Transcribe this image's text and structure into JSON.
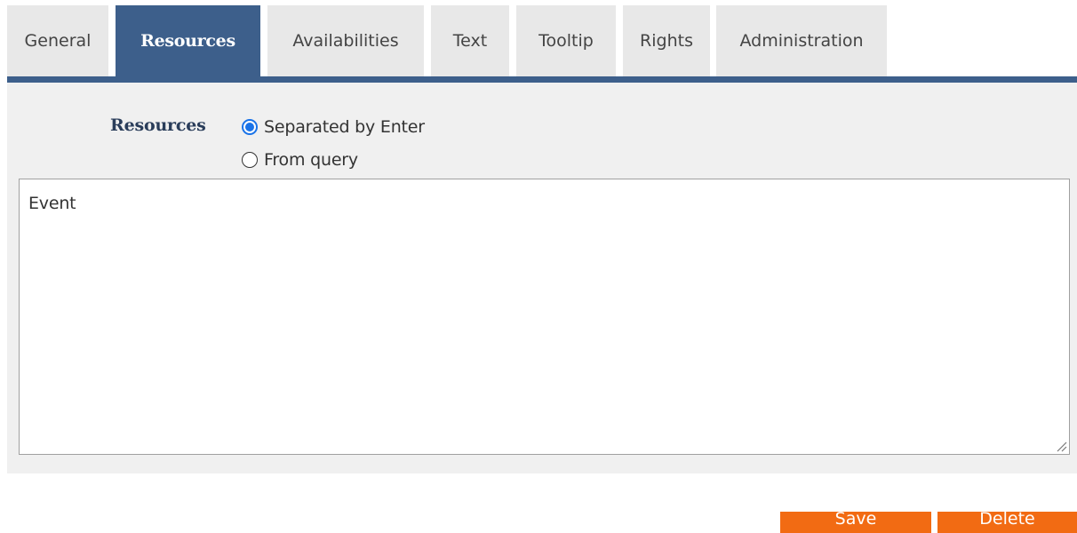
{
  "tabs": [
    {
      "label": "General",
      "active": false
    },
    {
      "label": "Resources",
      "active": true
    },
    {
      "label": "Availabilities",
      "active": false
    },
    {
      "label": "Text",
      "active": false
    },
    {
      "label": "Tooltip",
      "active": false
    },
    {
      "label": "Rights",
      "active": false
    },
    {
      "label": "Administration",
      "active": false
    }
  ],
  "resources_field": {
    "label": "Resources",
    "options": [
      {
        "label": "Separated by Enter",
        "checked": true
      },
      {
        "label": "From query",
        "checked": false
      }
    ],
    "textarea_value": "Event"
  },
  "actions": {
    "save_label": "Save",
    "delete_label": "Delete"
  },
  "colors": {
    "accent": "#3d5f8b",
    "button": "#f26b13",
    "radio_checked": "#1a73e8",
    "tab_bg": "#e8e8e8",
    "panel_bg": "#f0f0f0"
  }
}
